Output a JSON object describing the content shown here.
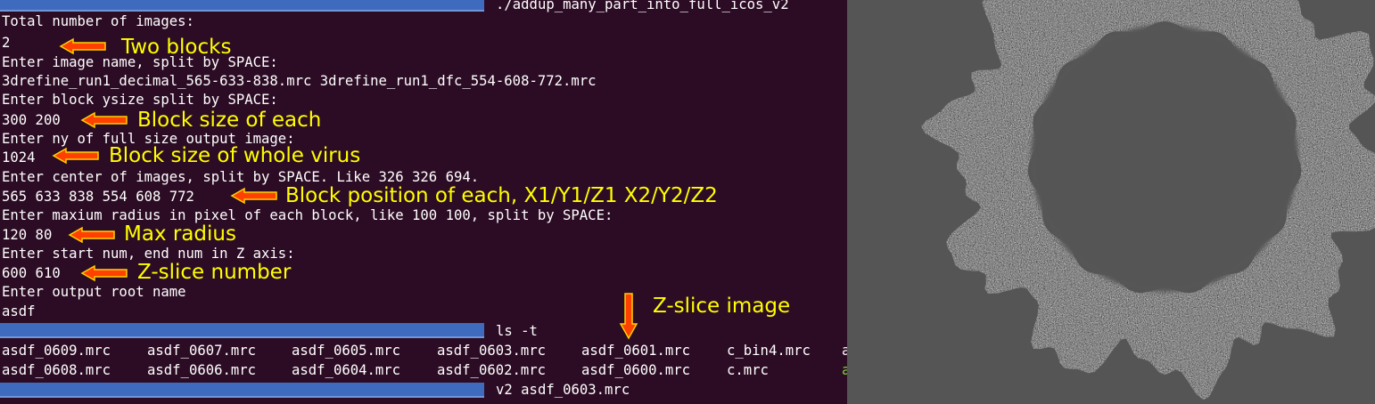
{
  "terminal": {
    "header_command": "./addup_many_part_into_full_icos_v2",
    "lines": [
      "Total number of images:",
      "2",
      "Enter image name, split by SPACE:",
      "3drefine_run1_decimal_565-633-838.mrc 3drefine_run1_dfc_554-608-772.mrc",
      "Enter block ysize split by SPACE:",
      "300 200",
      "Enter ny of full size output image:",
      "1024",
      "Enter center of images, split by SPACE. Like 326 326 694.",
      "565 633 838 554 608 772",
      "Enter maxium radius in pixel of each block, like 100 100, split by SPACE:",
      "120 80",
      "Enter start num, end num in Z axis:",
      "600 610",
      "Enter output root name",
      "asdf"
    ],
    "ls_command": "ls -t",
    "ls_row1": [
      "asdf_0609.mrc",
      "asdf_0607.mrc",
      "asdf_0605.mrc",
      "asdf_0603.mrc",
      "asdf_0601.mrc",
      "c_bin4.mrc",
      "a"
    ],
    "ls_row2": [
      "asdf_0608.mrc",
      "asdf_0606.mrc",
      "asdf_0604.mrc",
      "asdf_0602.mrc",
      "asdf_0600.mrc",
      "c.mrc",
      "a"
    ],
    "last_command": "v2 asdf_0603.mrc"
  },
  "annotations": {
    "two_blocks": "Two blocks",
    "block_size_each": "Block size of each",
    "block_size_virus": "Block size of whole virus",
    "block_position": "Block position of each, X1/Y1/Z1  X2/Y2/Z2",
    "max_radius": "Max radius",
    "z_slice_number": "Z-slice number",
    "z_slice_image": "Z-slice image"
  },
  "colors": {
    "terminal_bg": "#2c0c24",
    "prompt_bar": "#3f6bbf",
    "annotation_text": "#ffff00",
    "arrow_fill": "#ff4000",
    "image_bg": "#555555"
  },
  "image_viewer": {
    "content": "z-slice grayscale image of icosahedral virus ring"
  }
}
